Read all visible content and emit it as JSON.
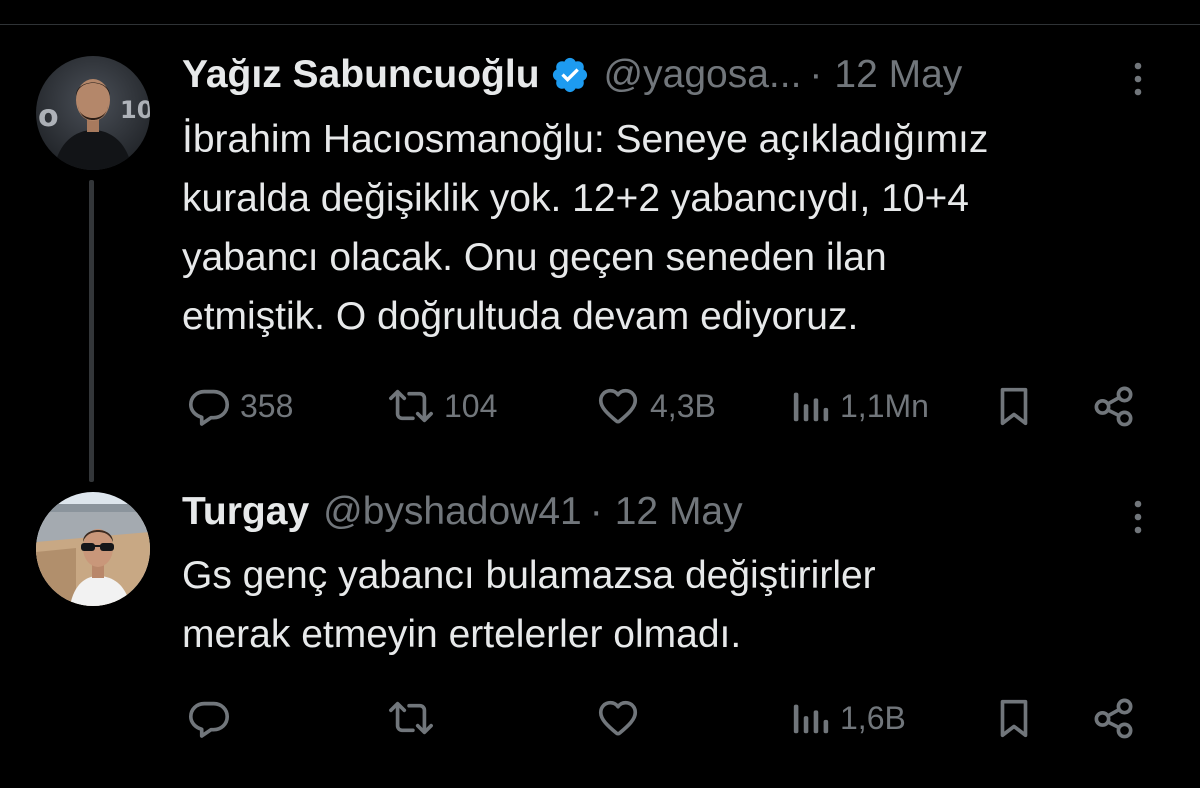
{
  "colors": {
    "background": "#000000",
    "text_primary": "#e7e9ea",
    "text_secondary": "#71767b",
    "verified_blue": "#1d9bf0",
    "thread_line": "#333639"
  },
  "tweets": [
    {
      "display_name": "Yağız Sabuncuoğlu",
      "verified": true,
      "handle": "@yagosa...",
      "separator": "·",
      "date": "12 May",
      "text_lines": [
        "İbrahim Hacıosmanoğlu: Seneye açıkladığımız",
        "kuralda değişiklik yok. 12+2 yabancıydı, 10+4",
        "yabancı olacak. Onu geçen seneden ilan",
        "etmiştik. O doğrultuda devam ediyoruz."
      ],
      "actions": {
        "replies": "358",
        "retweets": "104",
        "likes": "4,3B",
        "views": "1,1Mn"
      }
    },
    {
      "display_name": "Turgay",
      "verified": false,
      "handle": "@byshadow41",
      "separator": "·",
      "date": "12 May",
      "text_lines": [
        "Gs genç yabancı bulamazsa değiştirirler",
        "merak etmeyin ertelerler olmadı."
      ],
      "actions": {
        "replies": "",
        "retweets": "",
        "likes": "",
        "views": "1,6B"
      }
    }
  ]
}
